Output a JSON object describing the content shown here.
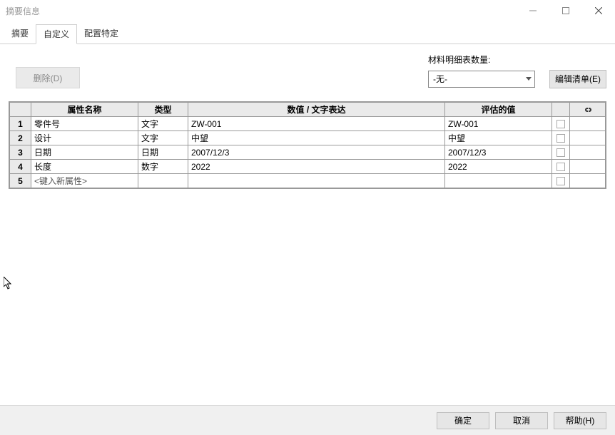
{
  "window": {
    "title": "摘要信息"
  },
  "tabs": {
    "summary": "摘要",
    "custom": "自定义",
    "config": "配置特定"
  },
  "toolbar": {
    "delete_label": "删除(D)",
    "bom_label": "材料明细表数量:",
    "bom_value": "-无-",
    "edit_list_label": "编辑清单(E)"
  },
  "grid": {
    "headers": {
      "name": "属性名称",
      "type": "类型",
      "value": "数值 / 文字表达",
      "eval": "评估的值"
    },
    "rows": [
      {
        "idx": "1",
        "name": "零件号",
        "type": "文字",
        "value": " ZW-001",
        "eval": " ZW-001"
      },
      {
        "idx": "2",
        "name": "设计",
        "type": "文字",
        "value": "中望",
        "eval": "中望"
      },
      {
        "idx": "3",
        "name": "日期",
        "type": "日期",
        "value": "2007/12/3",
        "eval": "2007/12/3"
      },
      {
        "idx": "4",
        "name": "长度",
        "type": "数字",
        "value": "2022",
        "eval": "2022"
      },
      {
        "idx": "5",
        "name": "<键入新属性>",
        "type": "",
        "value": "",
        "eval": ""
      }
    ]
  },
  "footer": {
    "ok": "确定",
    "cancel": "取消",
    "help": "帮助(H)"
  }
}
